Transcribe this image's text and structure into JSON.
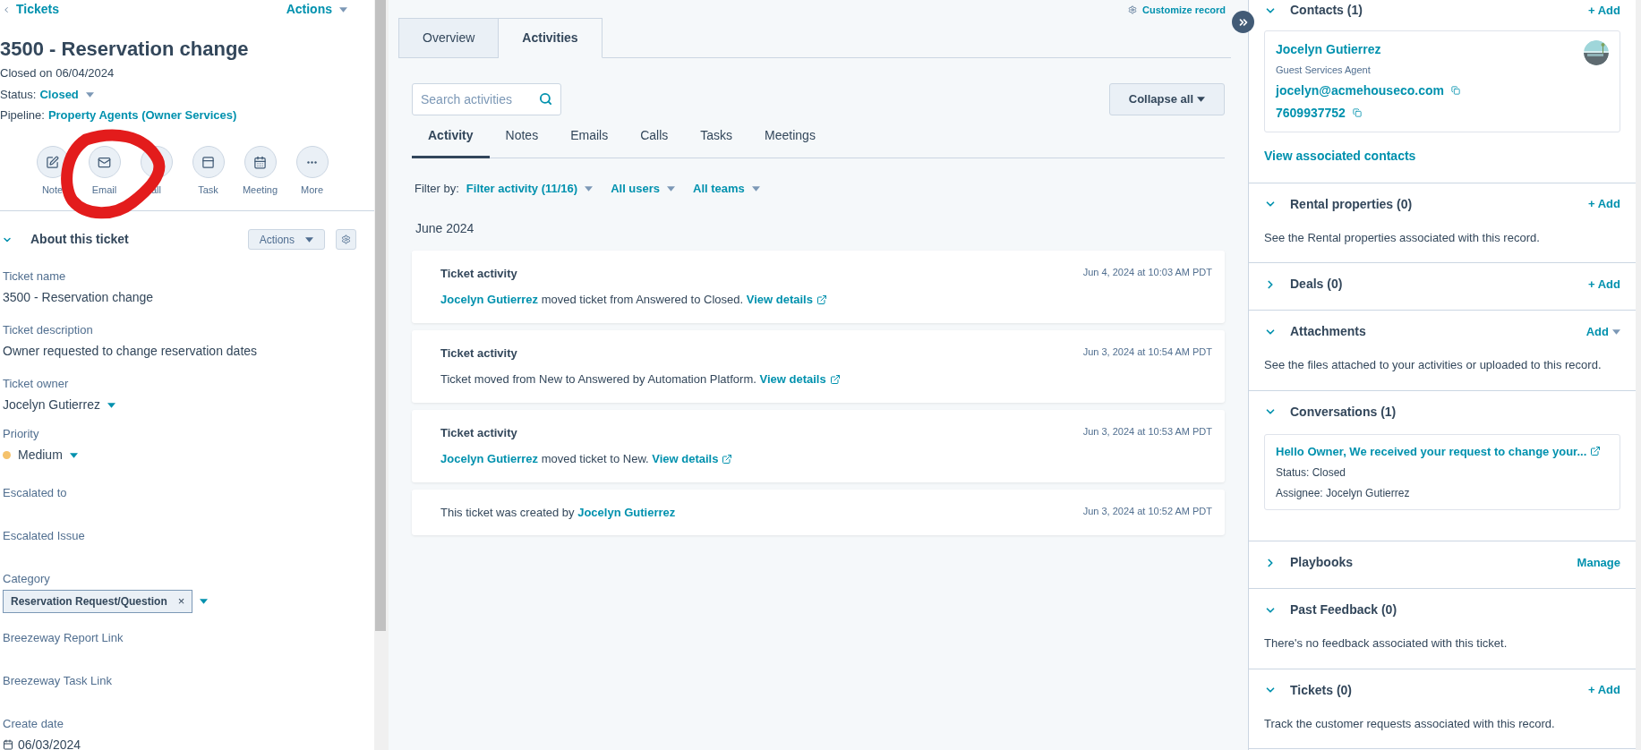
{
  "left": {
    "back_link": "Tickets",
    "actions": "Actions",
    "title": "3500 - Reservation change",
    "closed_on": "Closed on 06/04/2024",
    "status": {
      "label": "Status:",
      "value": "Closed"
    },
    "pipeline": {
      "label": "Pipeline:",
      "value": "Property Agents (Owner Services)"
    },
    "quick_actions": [
      {
        "kind": "note",
        "label": "Note"
      },
      {
        "kind": "email",
        "label": "Email"
      },
      {
        "kind": "call",
        "label": "all"
      },
      {
        "kind": "task",
        "label": "Task"
      },
      {
        "kind": "meeting",
        "label": "Meeting"
      },
      {
        "kind": "more",
        "label": "More"
      }
    ],
    "about": {
      "title": "About this ticket",
      "expanded": true,
      "actions_button": "Actions",
      "fields": [
        {
          "kind": "text",
          "label": "Ticket name",
          "value": "3500 - Reservation change"
        },
        {
          "kind": "text",
          "label": "Ticket description",
          "value": "Owner requested to change reservation dates"
        },
        {
          "kind": "dropdown",
          "label": "Ticket owner",
          "value": "Jocelyn Gutierrez"
        },
        {
          "kind": "priority",
          "label": "Priority",
          "value": "Medium",
          "color": "#f5c26b"
        },
        {
          "kind": "empty",
          "label": "Escalated to"
        },
        {
          "kind": "empty",
          "label": "Escalated Issue"
        },
        {
          "kind": "tag",
          "label": "Category",
          "value": "Reservation Request/Question",
          "remove_icon": "×"
        },
        {
          "kind": "empty",
          "label": "Breezeway Report Link"
        },
        {
          "kind": "empty",
          "label": "Breezeway Task Link"
        },
        {
          "kind": "date",
          "label": "Create date",
          "value": "06/03/2024"
        }
      ]
    }
  },
  "middle": {
    "customize": "Customize record",
    "tabs": [
      {
        "label": "Overview",
        "selected": false
      },
      {
        "label": "Activities",
        "selected": true
      }
    ],
    "search": {
      "placeholder": "Search activities"
    },
    "collapse_button": "Collapse all",
    "subtabs": [
      {
        "label": "Activity",
        "selected": true
      },
      {
        "label": "Notes",
        "selected": false
      },
      {
        "label": "Emails",
        "selected": false
      },
      {
        "label": "Calls",
        "selected": false
      },
      {
        "label": "Tasks",
        "selected": false
      },
      {
        "label": "Meetings",
        "selected": false
      }
    ],
    "filter_label": "Filter by:",
    "filters": [
      "Filter activity (11/16)",
      "All users",
      "All teams"
    ],
    "month": "June 2024",
    "activities": [
      {
        "title": "Ticket activity",
        "time": "Jun 4, 2024 at 10:03 AM PDT",
        "parts": [
          {
            "kind": "link",
            "text": "Jocelyn Gutierrez"
          },
          {
            "kind": "text",
            "text": " moved ticket from Answered to Closed. "
          },
          {
            "kind": "details",
            "text": "View details"
          }
        ]
      },
      {
        "title": "Ticket activity",
        "time": "Jun 3, 2024 at 10:54 AM PDT",
        "parts": [
          {
            "kind": "text",
            "text": "Ticket moved from New to Answered by Automation Platform. "
          },
          {
            "kind": "details",
            "text": "View details"
          }
        ]
      },
      {
        "title": "Ticket activity",
        "time": "Jun 3, 2024 at 10:53 AM PDT",
        "parts": [
          {
            "kind": "link",
            "text": "Jocelyn Gutierrez"
          },
          {
            "kind": "text",
            "text": " moved ticket to New. "
          },
          {
            "kind": "details",
            "text": "View details"
          }
        ]
      },
      {
        "time": "Jun 3, 2024 at 10:52 AM PDT",
        "parts": [
          {
            "kind": "text",
            "text": "This ticket was created by "
          },
          {
            "kind": "link",
            "text": "Jocelyn Gutierrez"
          }
        ]
      }
    ]
  },
  "right": {
    "sections": [
      {
        "title": "Contacts (1)",
        "expanded": true,
        "action": "+ Add",
        "has_menu": false,
        "contact": {
          "name": "Jocelyn Gutierrez",
          "role": "Guest Services Agent",
          "email": "jocelyn@acmehouseco.com",
          "phone": "7609937752"
        },
        "link": "View associated contacts"
      },
      {
        "title": "Rental properties (0)",
        "expanded": true,
        "action": "+ Add",
        "has_menu": false,
        "description": "See the Rental properties associated with this record."
      },
      {
        "title": "Deals (0)",
        "expanded": false,
        "action": "+ Add",
        "has_menu": false
      },
      {
        "title": "Attachments",
        "expanded": true,
        "action": "Add",
        "has_menu": true,
        "description": "See the files attached to your activities or uploaded to this record."
      },
      {
        "title": "Conversations (1)",
        "expanded": true,
        "conversation": {
          "subject": "Hello Owner, We received your request to change your...",
          "status": "Status: Closed",
          "assignee": "Assignee: Jocelyn Gutierrez"
        }
      },
      {
        "title": "Playbooks",
        "expanded": false,
        "action": "Manage",
        "has_menu": false
      },
      {
        "title": "Past Feedback (0)",
        "expanded": true,
        "description": "There's no feedback associated with this ticket."
      },
      {
        "title": "Tickets (0)",
        "expanded": true,
        "action": "+ Add",
        "has_menu": false,
        "description": "Track the customer requests associated with this record."
      }
    ]
  }
}
